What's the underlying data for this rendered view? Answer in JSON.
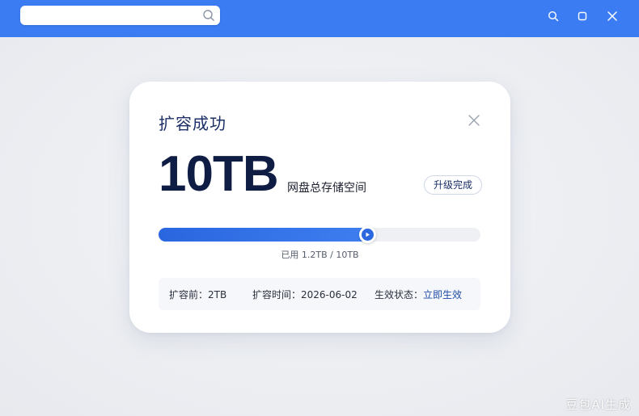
{
  "search": {
    "placeholder": ""
  },
  "dialog": {
    "title": "扩容成功",
    "capacity": "10TB",
    "capacity_label": "网盘总存储空间",
    "status_badge": "升级完成",
    "usage": {
      "used_fraction": 0.65,
      "text": "已用 1.2TB / 10TB"
    },
    "info": {
      "before_label": "扩容前：",
      "before_value": "2TB",
      "time_label": "扩容时间：",
      "time_value": "2026-06-02",
      "state_label": "生效状态：",
      "state_value": "立即生效"
    }
  },
  "watermark": "豆包AI生成",
  "colors": {
    "topbar": "#3b7cf2",
    "accent": "#2b67df",
    "title": "#1c2f66"
  },
  "icons": [
    "search-icon",
    "zoom-icon",
    "maximize-icon",
    "close-icon",
    "play-icon"
  ]
}
